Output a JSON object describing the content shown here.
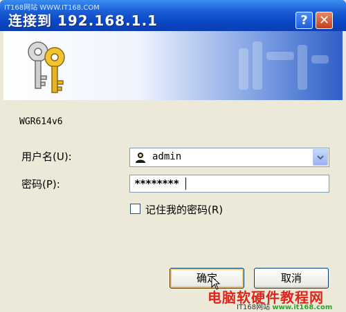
{
  "watermark_top": "IT168网站 WWW.IT168.COM",
  "window": {
    "title": "连接到 192.168.1.1",
    "help_label": "?",
    "close_label": "✕"
  },
  "banner": {
    "icon": "keys-icon"
  },
  "device_label": "WGR614v6",
  "form": {
    "username_label": "用户名(U):",
    "username_value": "admin",
    "password_label": "密码(P):",
    "password_value": "********",
    "remember_label": "记住我的密码(R)",
    "remember_checked": false
  },
  "buttons": {
    "ok_label": "确定",
    "cancel_label": "取消"
  },
  "watermark": {
    "red_text": "电脑软硬件教程网",
    "bottom_left": "IT168网站",
    "bottom_right": "www.it168.com"
  },
  "colors": {
    "titlebar": "#0a46c4",
    "dialog_bg": "#ece9d8",
    "watermark_red": "#e0241b"
  }
}
